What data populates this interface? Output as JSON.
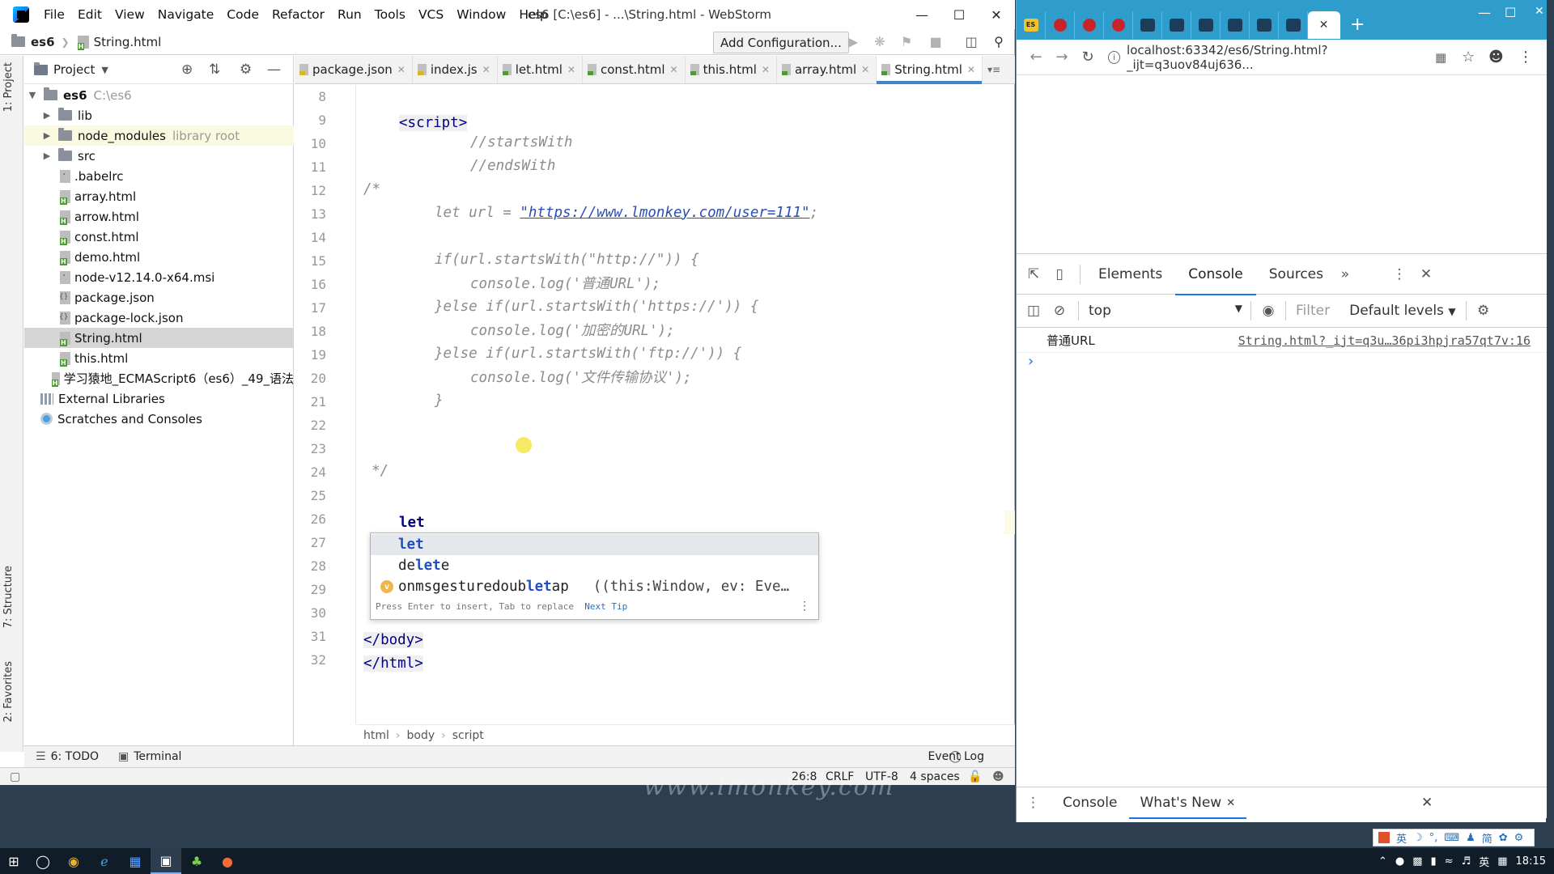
{
  "ide": {
    "menu": [
      "File",
      "Edit",
      "View",
      "Navigate",
      "Code",
      "Refactor",
      "Run",
      "Tools",
      "VCS",
      "Window",
      "Help"
    ],
    "title": "es6 [C:\\es6] - ...\\String.html - WebStorm",
    "breadcrumb": {
      "project": "es6",
      "file": "String.html"
    },
    "add_configuration": "Add Configuration...",
    "left_strip": {
      "project": "1: Project",
      "structure": "7: Structure",
      "favorites": "2: Favorites"
    },
    "project_panel": {
      "title": "Project",
      "tree": [
        {
          "label": "es6",
          "extra": "C:\\es6",
          "kind": "folder",
          "indent": 0,
          "expanded": true
        },
        {
          "label": "lib",
          "kind": "folder",
          "indent": 1
        },
        {
          "label": "node_modules",
          "extra": "library root",
          "kind": "folder",
          "indent": 1
        },
        {
          "label": "src",
          "kind": "folder",
          "indent": 1
        },
        {
          "label": ".babelrc",
          "kind": "g",
          "indent": 1
        },
        {
          "label": "array.html",
          "kind": "h",
          "indent": 1
        },
        {
          "label": "arrow.html",
          "kind": "h",
          "indent": 1
        },
        {
          "label": "const.html",
          "kind": "h",
          "indent": 1
        },
        {
          "label": "demo.html",
          "kind": "h",
          "indent": 1
        },
        {
          "label": "node-v12.14.0-x64.msi",
          "kind": "g",
          "indent": 1
        },
        {
          "label": "package.json",
          "kind": "j",
          "indent": 1
        },
        {
          "label": "package-lock.json",
          "kind": "j",
          "indent": 1
        },
        {
          "label": "String.html",
          "kind": "h",
          "indent": 1,
          "selected": true
        },
        {
          "label": "this.html",
          "kind": "h",
          "indent": 1
        },
        {
          "label": "学习猿地_ECMAScript6（es6）_49_语法",
          "kind": "h",
          "indent": 1
        },
        {
          "label": "External Libraries",
          "kind": "lib",
          "indent": 0
        },
        {
          "label": "Scratches and Consoles",
          "kind": "scratch",
          "indent": 0
        }
      ]
    },
    "tabs": [
      {
        "label": "package.json",
        "kind": "json"
      },
      {
        "label": "index.js",
        "kind": "js"
      },
      {
        "label": "let.html",
        "kind": "html"
      },
      {
        "label": "const.html",
        "kind": "html"
      },
      {
        "label": "this.html",
        "kind": "html"
      },
      {
        "label": "array.html",
        "kind": "html"
      },
      {
        "label": "String.html",
        "kind": "html",
        "active": true
      }
    ],
    "code_lines": [
      {
        "n": "8",
        "text": ""
      },
      {
        "n": "9",
        "text": "<script>"
      },
      {
        "n": "10",
        "text": "//startsWith"
      },
      {
        "n": "11",
        "text": "//endsWith"
      },
      {
        "n": "12",
        "text": "/*"
      },
      {
        "n": "13",
        "text": "let url = \"https://www.lmonkey.com/user=111\";"
      },
      {
        "n": "14",
        "text": ""
      },
      {
        "n": "15",
        "text": "if(url.startsWith(\"http://\")) {"
      },
      {
        "n": "16",
        "text": "console.log('普通URL');"
      },
      {
        "n": "17",
        "text": "}else if(url.startsWith('https://')) {"
      },
      {
        "n": "18",
        "text": "console.log('加密的URL');"
      },
      {
        "n": "19",
        "text": "}else if(url.startsWith('ftp://')) {"
      },
      {
        "n": "20",
        "text": "console.log('文件传输协议');"
      },
      {
        "n": "21",
        "text": "}"
      },
      {
        "n": "22",
        "text": ""
      },
      {
        "n": "23",
        "text": ""
      },
      {
        "n": "24",
        "text": "*/"
      },
      {
        "n": "25",
        "text": ""
      },
      {
        "n": "26",
        "text": "let"
      },
      {
        "n": "27",
        "text": ""
      },
      {
        "n": "28",
        "text": ""
      },
      {
        "n": "29",
        "text": ""
      },
      {
        "n": "30",
        "text": ""
      },
      {
        "n": "31",
        "text": "</body>"
      },
      {
        "n": "32",
        "text": "</html>"
      }
    ],
    "code_parts": {
      "script_open": "<script>",
      "c_starts": "//startsWith",
      "c_ends": "//endsWith",
      "block_open": "/*",
      "l13_a": "let url = ",
      "l13_url": "\"https://www.lmonkey.com/user=111\"",
      "l13_b": ";",
      "l15": "if(url.startsWith(\"http://\")) {",
      "l16": "console.log('普通URL');",
      "l17": "}else if(url.startsWith('https://')) {",
      "l18": "console.log('加密的URL');",
      "l19": "}else if(url.startsWith('ftp://')) {",
      "l20": "console.log('文件传输协议');",
      "l21": "}",
      "block_close": "*/",
      "l26": "let",
      "body_close": "</body>",
      "html_close": "</html>"
    },
    "autocomplete": {
      "items": [
        {
          "pre": "",
          "match": "let",
          "post": "",
          "type": "",
          "badge": ""
        },
        {
          "pre": "de",
          "match": "let",
          "post": "e",
          "type": "",
          "badge": ""
        },
        {
          "pre": "onmsgesturedoub",
          "match": "let",
          "post": "ap",
          "type": "((this:Window, ev: Eve…",
          "badge": "v"
        }
      ],
      "hint": "Press Enter to insert, Tab to replace",
      "next_tip": "Next Tip"
    },
    "editor_breadcrumb": [
      "html",
      "body",
      "script"
    ],
    "bottom_tools": {
      "todo": "6: TODO",
      "terminal": "Terminal",
      "event_log": "Event Log"
    },
    "status": {
      "position": "26:8",
      "line_sep": "CRLF",
      "encoding": "UTF-8",
      "indent": "4 spaces"
    }
  },
  "browser": {
    "url": "localhost:63342/es6/String.html?_ijt=q3uov84uj636...",
    "devtools": {
      "tabs": [
        "Elements",
        "Console",
        "Sources"
      ],
      "active_tab": "Console",
      "context": "top",
      "filter_placeholder": "Filter",
      "levels": "Default levels",
      "log": {
        "message": "普通URL",
        "source": "String.html?_ijt=q3u…36pi3hpjra57qt7v:16"
      },
      "drawer_tabs": [
        "Console",
        "What's New"
      ]
    }
  },
  "taskbar": {
    "clock": "18:15",
    "ime": "英"
  },
  "ime_bar": [
    "英",
    "简"
  ],
  "colors": {
    "active_tab_accent": "#4083c9",
    "browser_chrome": "#2e9dcc",
    "devtools_accent": "#1a73e8"
  }
}
